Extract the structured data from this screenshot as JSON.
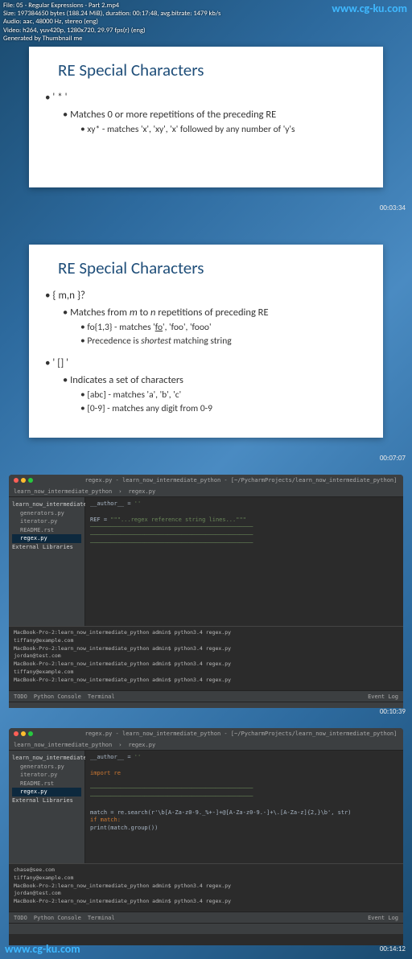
{
  "meta": {
    "file": "File: 05 - Regular Expressions - Part 2.mp4",
    "size": "Size: 197384650 bytes (188.24 MiB), duration: 00:17:48, avg.bitrate: 1479 kb/s",
    "audio": "Audio: aac, 48000 Hz, stereo (eng)",
    "video": "Video: h264, yuv420p, 1280x720, 29.97 fps(r) (eng)",
    "gen": "Generated by Thumbnail me"
  },
  "watermark": "www.cg-ku.com",
  "timestamps": {
    "t1": "00:03:34",
    "t2": "00:07:07",
    "t3": "00:10:39",
    "t4": "00:14:12"
  },
  "slide1": {
    "title": "RE  Special Characters",
    "b1": "' * '",
    "b2": "Matches 0 or more repetitions of the preceding RE",
    "b3": "xy*   - matches 'x', 'xy', 'x' followed by any number of 'y's"
  },
  "slide2": {
    "title": "RE  Special Characters",
    "b1a": "{ m,n }?",
    "b2a_pre": "Matches from ",
    "b2a_m": "m",
    "b2a_mid": " to ",
    "b2a_n": "n",
    "b2a_post": " repetitions of preceding RE",
    "b3a_pre": "fo{1,3}        - matches '",
    "b3a_u": "fo",
    "b3a_post": "', 'foo', 'fooo'",
    "b3b_pre": "Precedence is ",
    "b3b_em": "shortest",
    "b3b_post": " matching string",
    "b1b": "' [] '",
    "b2b": "Indicates a set of characters",
    "b3c": "[abc]          - matches 'a', 'b', 'c'",
    "b3d": "[0-9]           - matches any digit from 0-9"
  },
  "ide": {
    "title": "regex.py - learn_now_intermediate_python - [~/PycharmProjects/learn_now_intermediate_python]",
    "breadcrumb": "learn_now_intermediate_python",
    "tab": "regex.py",
    "project": {
      "root": "learn_now_intermediate_python",
      "files": [
        "generators.py",
        "iterator.py",
        "README.rst",
        "regex.py"
      ],
      "lib": "External Libraries"
    },
    "code1": {
      "l1": "__author__ = ",
      "l3": "REF = ",
      "lines": "\"\"\"...regex reference string lines...\"\"\""
    },
    "code2": {
      "imp": "import re",
      "match": "match = re.search(r'\\b[A-Za-z0-9._%+-]+@[A-Za-z0-9.-]+\\.[A-Za-z]{2,}\\b', str)",
      "ifm": "if match:",
      "prt": "    print(match.group())"
    },
    "terminal": {
      "prompt": "MacBook-Pro-2:learn_now_intermediate_python admin$ python3.4 regex.py",
      "out1": "tiffany@example.com",
      "out2": "jordan@test.com",
      "out3": "chase@see.com"
    },
    "tabs": {
      "todo": "TODO",
      "console": "Python Console",
      "term": "Terminal",
      "log": "Event Log"
    }
  }
}
